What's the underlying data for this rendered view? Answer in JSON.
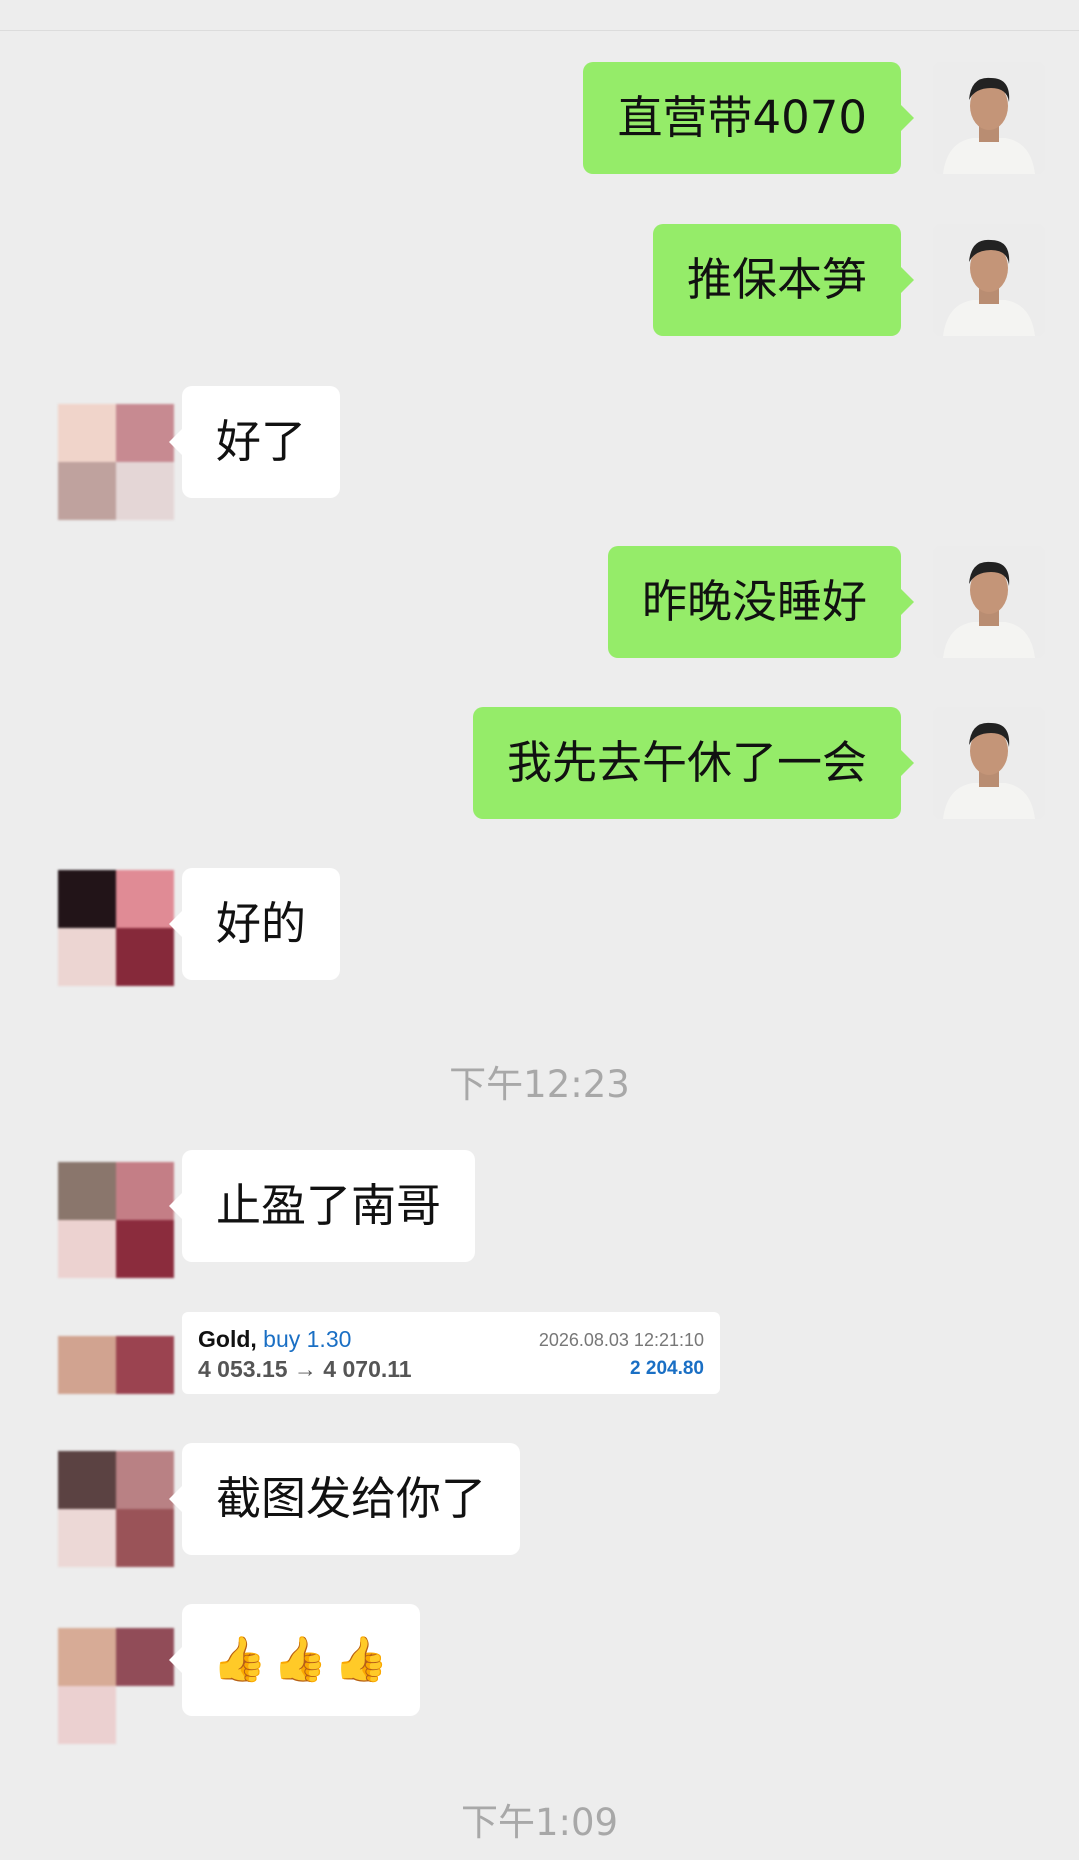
{
  "messages": [
    {
      "side": "out",
      "text": "直营带4070"
    },
    {
      "side": "out",
      "text": "推保本笋"
    },
    {
      "side": "in",
      "text": "好了"
    },
    {
      "side": "out",
      "text": "昨晚没睡好"
    },
    {
      "side": "out",
      "text": "我先去午休了一会"
    },
    {
      "side": "in",
      "text": "好的"
    },
    {
      "side": "in",
      "text": "止盈了南哥"
    },
    {
      "side": "in",
      "text": "截图发给你了"
    }
  ],
  "timestamps": [
    "下午12:23",
    "下午1:09"
  ],
  "trade_card": {
    "symbol": "Gold,",
    "action": "buy 1.30",
    "prices": "4 053.15 → 4 070.11",
    "datetime": "2026.08.03 12:21:10",
    "profit": "2 204.80"
  },
  "emoji_message": {
    "emojis": [
      "👍",
      "👍",
      "👍"
    ],
    "icon": "thumbs-up-icon"
  },
  "colors": {
    "outgoing_bubble": "#95ec69",
    "incoming_bubble": "#ffffff",
    "background": "#ededed",
    "profit": "#1a6fc4"
  }
}
